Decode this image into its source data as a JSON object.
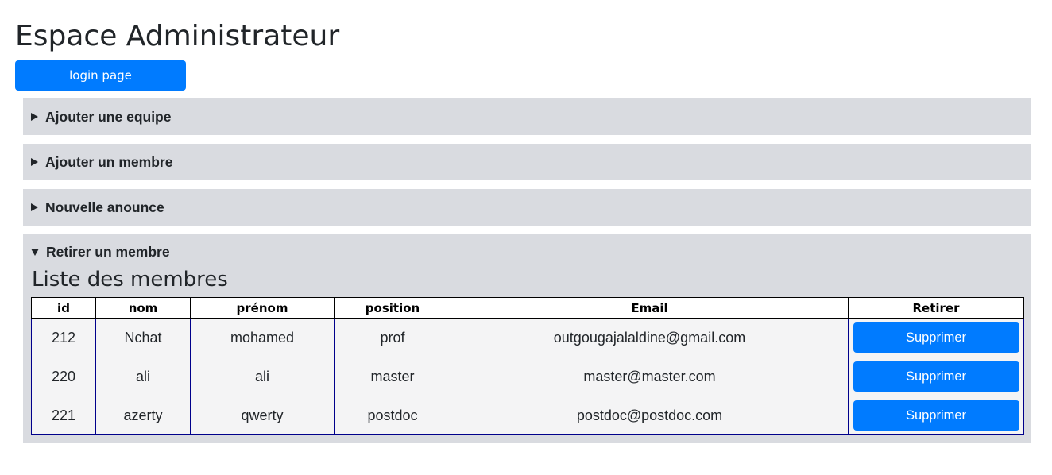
{
  "header": {
    "title": "Espace Administrateur",
    "login_button": "login page"
  },
  "sections": [
    {
      "label": "Ajouter une equipe",
      "expanded": false
    },
    {
      "label": "Ajouter un membre",
      "expanded": false
    },
    {
      "label": "Nouvelle anounce",
      "expanded": false
    },
    {
      "label": "Retirer un membre",
      "expanded": true
    }
  ],
  "members": {
    "title": "Liste des membres",
    "columns": [
      "id",
      "nom",
      "prénom",
      "position",
      "Email",
      "Retirer"
    ],
    "rows": [
      {
        "id": "212",
        "nom": "Nchat",
        "prenom": "mohamed",
        "position": "prof",
        "email": "outgougajalaldine@gmail.com",
        "action": "Supprimer"
      },
      {
        "id": "220",
        "nom": "ali",
        "prenom": "ali",
        "position": "master",
        "email": "master@master.com",
        "action": "Supprimer"
      },
      {
        "id": "221",
        "nom": "azerty",
        "prenom": "qwerty",
        "position": "postdoc",
        "email": "postdoc@postdoc.com",
        "action": "Supprimer"
      }
    ]
  },
  "colors": {
    "primary": "#007bff",
    "section_bg": "#d9dbe0",
    "row_bg": "#f4f4f5",
    "row_border": "#00008b"
  }
}
